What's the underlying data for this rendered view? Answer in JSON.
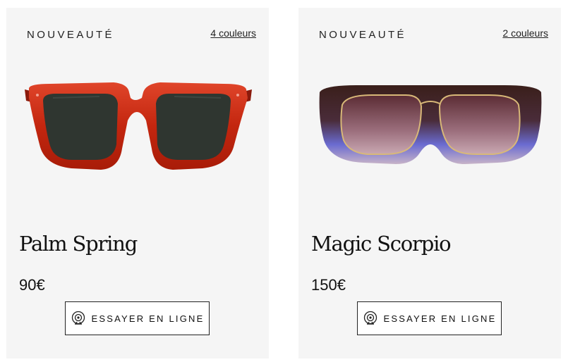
{
  "products": [
    {
      "badge": "NOUVEAUTÉ",
      "colors_link": "4 couleurs",
      "name": "Palm Spring",
      "price": "90€",
      "try_label": "ESSAYER EN LIGNE",
      "image": "red-square-sunglasses"
    },
    {
      "badge": "NOUVEAUTÉ",
      "colors_link": "2 couleurs",
      "name": "Magic Scorpio",
      "price": "150€",
      "try_label": "ESSAYER EN LIGNE",
      "image": "brown-purple-mask-sunglasses"
    }
  ],
  "colors": {
    "card_bg": "#f5f5f5",
    "text": "#111111",
    "frame_red": "#c02a14",
    "frame_brown": "#3a2420",
    "frame_purple": "#5a5fc8"
  },
  "icons": {
    "try_on": "webcam-icon"
  }
}
